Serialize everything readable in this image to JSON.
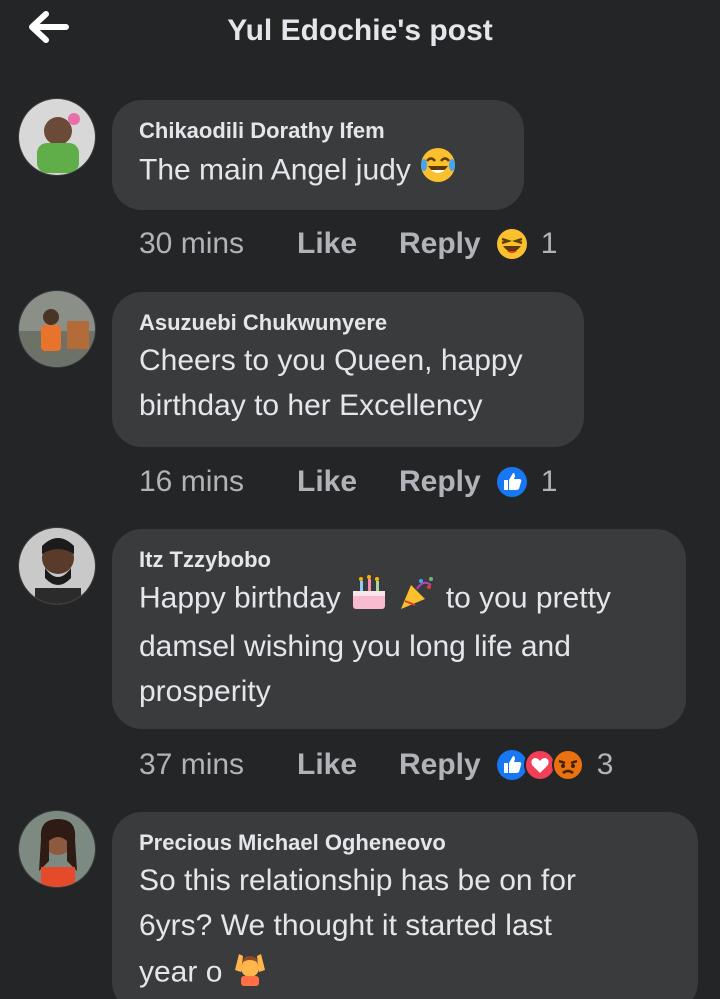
{
  "header": {
    "title": "Yul Edochie's post",
    "back_icon": "arrow-left-icon"
  },
  "colors": {
    "background": "#242526",
    "bubble": "#3a3b3c",
    "text": "#e4e6eb",
    "meta": "#b0b3b8",
    "like_blue": "#1877f2",
    "love_red": "#f33e58",
    "angry_orange": "#e9710f"
  },
  "comments": [
    {
      "author": "Chikaodili Dorathy Ifem",
      "lines": [
        "The main Angel judy"
      ],
      "emoji_after": "laughing-tears-emoji",
      "time": "30 mins",
      "like_label": "Like",
      "reply_label": "Reply",
      "reactions": [
        "haha"
      ],
      "reaction_count": "1"
    },
    {
      "author": "Asuzuebi Chukwunyere",
      "lines": [
        "Cheers to you Queen, happy",
        "birthday to her Excellency"
      ],
      "time": "16 mins",
      "like_label": "Like",
      "reply_label": "Reply",
      "reactions": [
        "like"
      ],
      "reaction_count": "1"
    },
    {
      "author": "Itz Tzzybobo",
      "line1_start": "Happy birthday",
      "line1_end": "to you pretty",
      "lines_rest": [
        "damsel wishing you long life and",
        "prosperity"
      ],
      "inline_emojis": [
        "birthday-cake-emoji",
        "party-popper-emoji"
      ],
      "time": "37 mins",
      "like_label": "Like",
      "reply_label": "Reply",
      "reactions": [
        "like",
        "love",
        "angry"
      ],
      "reaction_count": "3"
    },
    {
      "author": "Precious Michael Ogheneovo",
      "lines": [
        "So this relationship has be on for",
        "6yrs? We thought it started last",
        "year o"
      ],
      "emoji_after": "person-raising-hands-emoji"
    }
  ]
}
